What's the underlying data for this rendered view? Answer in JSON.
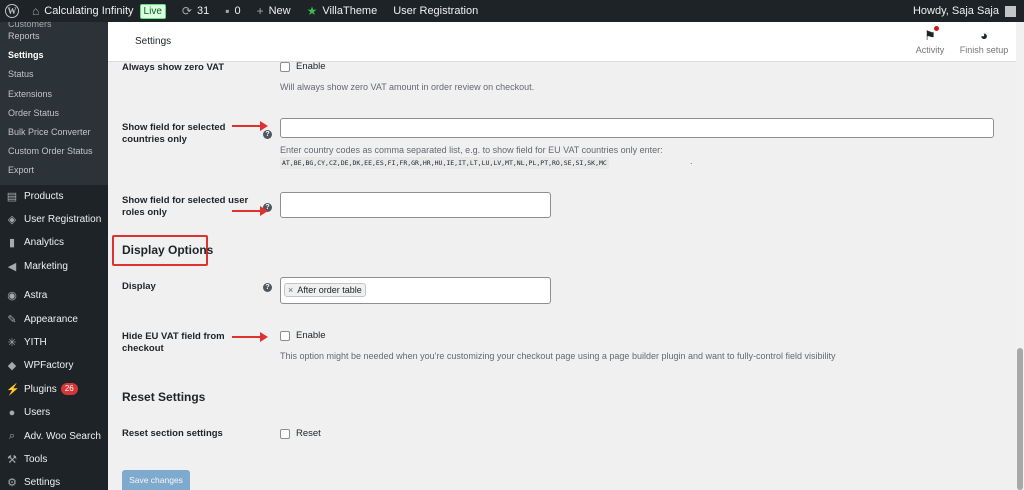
{
  "adminbar": {
    "site_name": "Calculating Infinity",
    "live_badge": "Live",
    "updates_count": "31",
    "comments_count": "0",
    "new_label": "New",
    "villatheme_label": "VillaTheme",
    "user_registration_label": "User Registration",
    "howdy": "Howdy, Saja Saja"
  },
  "sidebar": {
    "submenu_cut": "Customers",
    "submenu": [
      "Reports",
      "Settings",
      "Status",
      "Extensions",
      "Order Status",
      "Bulk Price Converter",
      "Custom Order Status",
      "Export"
    ],
    "menu": [
      {
        "label": "Products",
        "icon": "products-icon"
      },
      {
        "label": "User Registration",
        "icon": "user-registration-icon"
      },
      {
        "label": "Analytics",
        "icon": "analytics-icon"
      },
      {
        "label": "Marketing",
        "icon": "marketing-icon"
      },
      {
        "label": "Astra",
        "icon": "astra-icon"
      },
      {
        "label": "Appearance",
        "icon": "appearance-icon"
      },
      {
        "label": "YITH",
        "icon": "yith-icon"
      },
      {
        "label": "WPFactory",
        "icon": "wpfactory-icon"
      },
      {
        "label": "Plugins",
        "icon": "plugins-icon"
      },
      {
        "label": "Users",
        "icon": "users-icon"
      },
      {
        "label": "Adv. Woo Search",
        "icon": "search-icon"
      },
      {
        "label": "Tools",
        "icon": "tools-icon"
      },
      {
        "label": "Settings",
        "icon": "settings-icon"
      }
    ],
    "plugins_count": "26"
  },
  "header": {
    "title": "Settings",
    "activity_label": "Activity",
    "finish_setup_label": "Finish setup"
  },
  "form": {
    "zero_vat": {
      "label": "Always show zero VAT",
      "checkbox_label": "Enable",
      "description": "Will always show zero VAT amount in order review on checkout."
    },
    "countries": {
      "label_line1": "Show field for selected",
      "label_line2": "countries only",
      "value": "",
      "description": "Enter country codes as comma separated list, e.g. to show field for EU VAT countries only enter:",
      "codes": "AT,BE,BG,CY,CZ,DE,DK,EE,ES,FI,FR,GR,HR,HU,IE,IT,LT,LU,LV,MT,NL,PL,PT,RO,SE,SI,SK,MC",
      "codes_suffix": "."
    },
    "user_roles": {
      "label_line1": "Show field for selected user",
      "label_line2": "roles only",
      "value": ""
    },
    "display_options_title": "Display Options",
    "display": {
      "label": "Display",
      "selected_tag": "After order table",
      "tag_remove": "×"
    },
    "hide_field": {
      "label_line1": "Hide EU VAT field from",
      "label_line2": "checkout",
      "checkbox_label": "Enable",
      "description": "This option might be needed when you're customizing your checkout page using a page builder plugin and want to fully-control field visibility"
    },
    "reset_settings_title": "Reset Settings",
    "reset": {
      "label": "Reset section settings",
      "checkbox_label": "Reset"
    },
    "save_button": "Save changes",
    "help_glyph": "?"
  },
  "colors": {
    "admin_dark": "#1d2327",
    "accent_blue": "#2271b1",
    "annotation_red": "#e03131"
  }
}
